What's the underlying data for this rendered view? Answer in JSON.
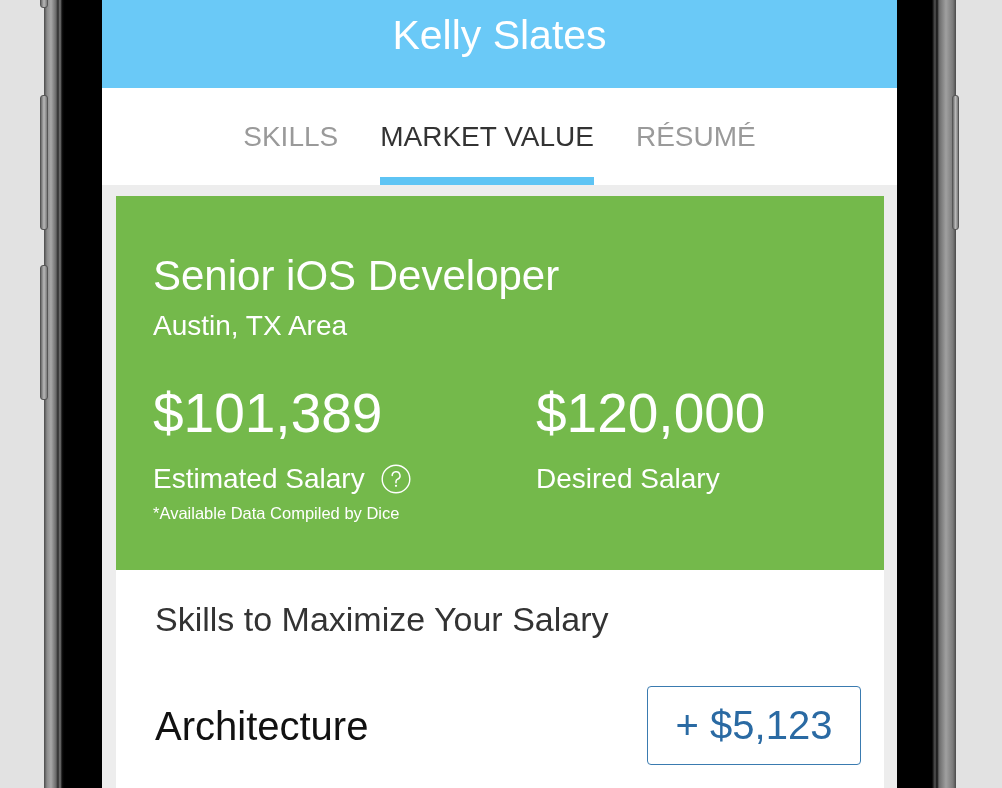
{
  "header": {
    "title": "Kelly Slates"
  },
  "tabs": [
    {
      "label": "SKILLS",
      "selected": false
    },
    {
      "label": "MARKET VALUE",
      "selected": true
    },
    {
      "label": "RÉSUMÉ",
      "selected": false
    }
  ],
  "job_card": {
    "title": "Senior iOS Developer",
    "location": "Austin, TX Area",
    "salaries": [
      {
        "amount": "$101,389",
        "label": "Estimated Salary",
        "info_icon": true,
        "note": "*Available Data Compiled by Dice"
      },
      {
        "amount": "$120,000",
        "label": "Desired Salary",
        "info_icon": false
      }
    ]
  },
  "skills_section": {
    "heading": "Skills to Maximize Your Salary",
    "skills": [
      {
        "name": "Architecture",
        "value": "+ $5,123"
      }
    ]
  }
}
